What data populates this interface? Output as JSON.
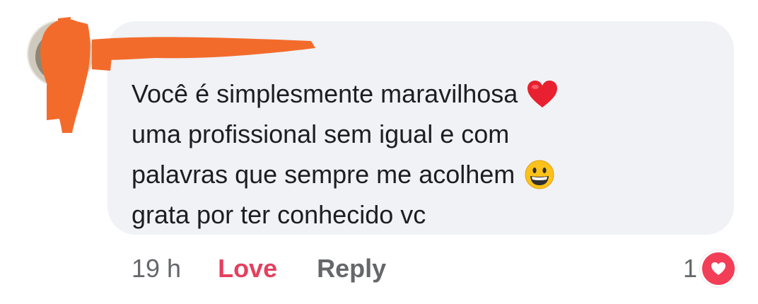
{
  "comment": {
    "author": "",
    "lines": [
      "Você é simplesmente maravilhosa",
      "uma profissional sem igual e com",
      "palavras que sempre me acolhem",
      "grata por ter conhecido vc"
    ],
    "emojis": [
      "red-heart",
      "grinning-face"
    ]
  },
  "actions": {
    "time": "19 h",
    "love_label": "Love",
    "reply_label": "Reply"
  },
  "reactions": {
    "count": "1",
    "icon": "love-reaction",
    "color": "#f33e58"
  },
  "colors": {
    "bubble": "#f0f2f5",
    "love": "#e4405f",
    "meta": "#65676b",
    "redaction": "#f26b2b"
  }
}
